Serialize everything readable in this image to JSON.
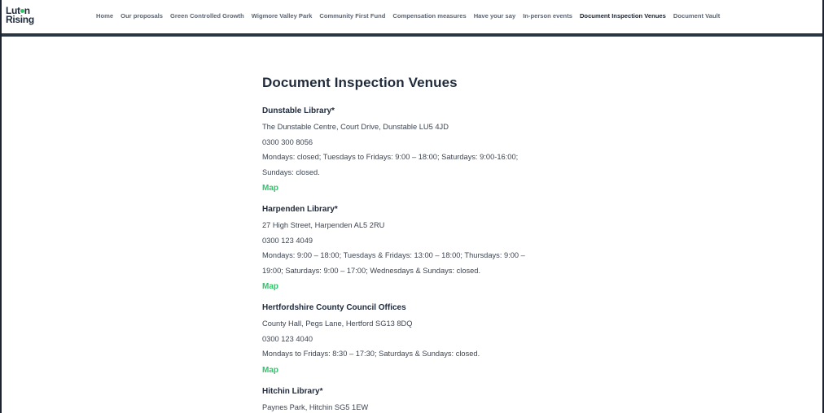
{
  "brand": {
    "logo_line1_a": "Lut",
    "logo_line1_b": "n",
    "logo_line2": "Rising",
    "accent": "#2ec66a",
    "dark": "#1f2a3b"
  },
  "nav": {
    "items": [
      {
        "label": "Home"
      },
      {
        "label": "Our proposals"
      },
      {
        "label": "Green Controlled Growth"
      },
      {
        "label": "Wigmore Valley Park"
      },
      {
        "label": "Community First Fund"
      },
      {
        "label": "Compensation measures"
      },
      {
        "label": "Have your say"
      },
      {
        "label": "In-person events"
      },
      {
        "label": "Document Inspection Venues",
        "active": true
      },
      {
        "label": "Document Vault"
      }
    ]
  },
  "page": {
    "title": "Document Inspection Venues"
  },
  "venues": [
    {
      "name": "Dunstable Library*",
      "address": "The Dunstable Centre, Court Drive, Dunstable LU5 4JD",
      "phone": "0300 300 8056",
      "hours_line1": "Mondays: closed; Tuesdays to Fridays: 9:00 – 18:00; Saturdays: 9:00-16:00;",
      "hours_line2": "Sundays: closed.",
      "map_label": "Map"
    },
    {
      "name": "Harpenden Library*",
      "address": "27 High Street, Harpenden AL5 2RU",
      "phone": "0300 123 4049",
      "hours_line1": "Mondays: 9:00 – 18:00; Tuesdays & Fridays: 13:00 – 18:00; Thursdays: 9:00 –",
      "hours_line2": "19:00; Saturdays: 9:00 – 17:00; Wednesdays & Sundays: closed.",
      "map_label": "Map"
    },
    {
      "name": "Hertfordshire County Council Offices",
      "address": "County Hall, Pegs Lane, Hertford SG13 8DQ",
      "phone": "0300 123 4040",
      "hours_line1": "Mondays to Fridays: 8:30 – 17:30; Saturdays & Sundays: closed.",
      "map_label": "Map"
    },
    {
      "name": "Hitchin Library*",
      "address": "Paynes Park, Hitchin SG5 1EW"
    }
  ]
}
